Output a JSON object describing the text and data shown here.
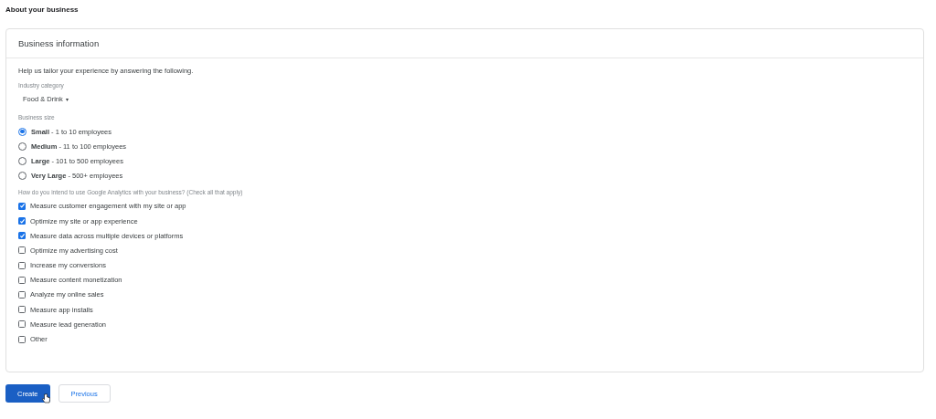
{
  "page_title": "About your business",
  "card": {
    "title": "Business information",
    "intro": "Help us tailor your experience by answering the following.",
    "industry": {
      "label": "Industry category",
      "value": "Food & Drink",
      "caret": "▾"
    },
    "size": {
      "label": "Business size",
      "options": [
        {
          "name": "Small",
          "detail": " - 1 to 10 employees",
          "selected": true
        },
        {
          "name": "Medium",
          "detail": " - 11 to 100 employees",
          "selected": false
        },
        {
          "name": "Large",
          "detail": " - 101 to 500 employees",
          "selected": false
        },
        {
          "name": "Very Large",
          "detail": " - 500+ employees",
          "selected": false
        }
      ]
    },
    "usage": {
      "label": "How do you intend to use Google Analytics with your business? (Check all that apply)",
      "options": [
        {
          "label": "Measure customer engagement with my site or app",
          "checked": true
        },
        {
          "label": "Optimize my site or app experience",
          "checked": true
        },
        {
          "label": "Measure data across multiple devices or platforms",
          "checked": true
        },
        {
          "label": "Optimize my advertising cost",
          "checked": false
        },
        {
          "label": "Increase my conversions",
          "checked": false
        },
        {
          "label": "Measure content monetization",
          "checked": false
        },
        {
          "label": "Analyze my online sales",
          "checked": false
        },
        {
          "label": "Measure app installs",
          "checked": false
        },
        {
          "label": "Measure lead generation",
          "checked": false
        },
        {
          "label": "Other",
          "checked": false
        }
      ]
    }
  },
  "buttons": [
    {
      "label": "Create",
      "kind": "primary"
    },
    {
      "label": "Previous",
      "kind": "secondary"
    }
  ]
}
